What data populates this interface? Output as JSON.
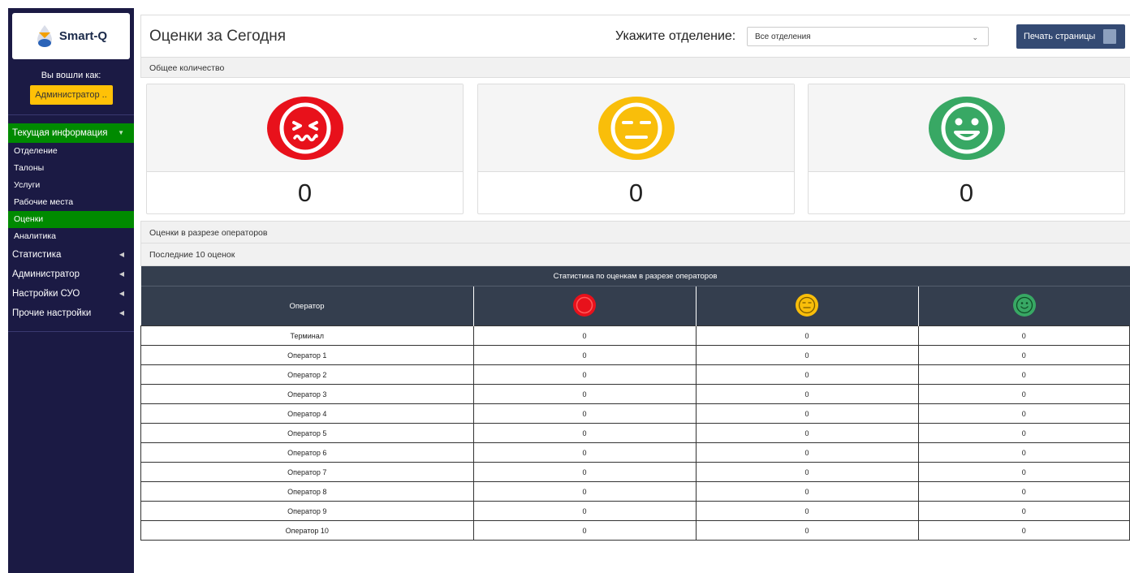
{
  "sidebar": {
    "logo_text": "Smart-Q",
    "logged_as_label": "Вы вошли как:",
    "user_button": "Администратор ..",
    "menu": {
      "current_info": "Текущая информация",
      "items": [
        "Отделение",
        "Талоны",
        "Услуги",
        "Рабочие места",
        "Оценки",
        "Аналитика"
      ],
      "statistics": "Статистика",
      "administrator": "Администратор",
      "suo_settings": "Настройки СУО",
      "other_settings": "Прочие настройки"
    }
  },
  "header": {
    "title": "Оценки за Сегодня",
    "dept_label": "Укажите отделение:",
    "dept_value": "Все отделения",
    "print_button": "Печать страницы"
  },
  "summary": {
    "section_title": "Общее количество",
    "negative_count": "0",
    "neutral_count": "0",
    "positive_count": "0"
  },
  "operators_section": "Оценки в разрезе операторов",
  "last_ten_section": "Последние 10 оценок",
  "table": {
    "caption": "Статистика по оценкам в разрезе операторов",
    "operator_header": "Оператор",
    "rows": [
      {
        "name": "Терминал",
        "neg": "0",
        "neu": "0",
        "pos": "0"
      },
      {
        "name": "Оператор 1",
        "neg": "0",
        "neu": "0",
        "pos": "0"
      },
      {
        "name": "Оператор 2",
        "neg": "0",
        "neu": "0",
        "pos": "0"
      },
      {
        "name": "Оператор 3",
        "neg": "0",
        "neu": "0",
        "pos": "0"
      },
      {
        "name": "Оператор 4",
        "neg": "0",
        "neu": "0",
        "pos": "0"
      },
      {
        "name": "Оператор 5",
        "neg": "0",
        "neu": "0",
        "pos": "0"
      },
      {
        "name": "Оператор 6",
        "neg": "0",
        "neu": "0",
        "pos": "0"
      },
      {
        "name": "Оператор 7",
        "neg": "0",
        "neu": "0",
        "pos": "0"
      },
      {
        "name": "Оператор 8",
        "neg": "0",
        "neu": "0",
        "pos": "0"
      },
      {
        "name": "Оператор 9",
        "neg": "0",
        "neu": "0",
        "pos": "0"
      },
      {
        "name": "Оператор 10",
        "neg": "0",
        "neu": "0",
        "pos": "0"
      }
    ]
  },
  "colors": {
    "sidebar_bg": "#1b1a44",
    "active_green": "#008a00",
    "user_button_yellow": "#ffc107",
    "negative": "#e8111b",
    "neutral": "#f9be0a",
    "positive": "#38a864",
    "print_button": "#344a73",
    "table_header": "#343e4e"
  },
  "icons": {
    "negative": "angry-face-icon",
    "neutral": "neutral-face-icon",
    "positive": "smile-face-icon",
    "print": "printer-icon"
  }
}
